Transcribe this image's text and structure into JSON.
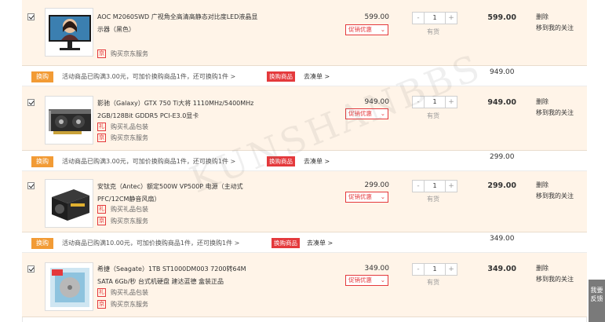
{
  "items": [
    {
      "title": "AOC M2060SWD 广视角全高清高静态对比度LED液晶显示器（黑色）",
      "services": [
        {
          "icon": "京",
          "label": "购买京东服务"
        }
      ],
      "unit_price": "599.00",
      "promo_select": "促销优惠",
      "qty": "1",
      "stock": "有货",
      "subtotal": "599.00",
      "ops": [
        "删除",
        "移到我的关注"
      ]
    },
    {
      "title": "影驰（Galaxy）GTX 750 Ti大将 1110MHz/5400MHz 2GB/128Bit GDDR5 PCI-E3.0显卡",
      "services": [
        {
          "icon": "礼",
          "label": "购买礼品包装"
        },
        {
          "icon": "京",
          "label": "购买京东服务"
        }
      ],
      "unit_price": "949.00",
      "promo_select": "促销优惠",
      "qty": "1",
      "stock": "有货",
      "subtotal": "949.00",
      "ops": [
        "删除",
        "移到我的关注"
      ]
    },
    {
      "title": "安钛克（Antec）额定500W VP500P 电源（主动式PFC/12CM静音风扇）",
      "services": [
        {
          "icon": "礼",
          "label": "购买礼品包装"
        },
        {
          "icon": "京",
          "label": "购买京东服务"
        }
      ],
      "unit_price": "299.00",
      "promo_select": "促销优惠",
      "qty": "1",
      "stock": "有货",
      "subtotal": "299.00",
      "ops": [
        "删除",
        "移到我的关注"
      ]
    },
    {
      "title": "希捷（Seagate）1TB ST1000DM003 7200转64M SATA 6Gb/秒 台式机硬盘 建达蓝德 盒装正品",
      "services": [
        {
          "icon": "礼",
          "label": "购买礼品包装"
        },
        {
          "icon": "京",
          "label": "购买京东服务"
        }
      ],
      "unit_price": "349.00",
      "promo_select": "促销优惠",
      "qty": "1",
      "stock": "有货",
      "subtotal": "349.00",
      "ops": [
        "删除",
        "移到我的关注"
      ]
    }
  ],
  "promos": [
    {
      "badge": "换购",
      "text": "活动商品已购满3.00元，可加价换购商品1件，还可换购1件 >",
      "tag": "换购商品",
      "link": "去凑单 >",
      "amount": "949.00"
    },
    {
      "badge": "换购",
      "text": "活动商品已购满3.00元，可加价换购商品1件，还可换购1件 >",
      "tag": "换购商品",
      "link": "去凑单 >",
      "amount": "299.00"
    },
    {
      "badge": "换购",
      "text": "活动商品已购满10.00元，可加价换购商品1件，还可换购1件 >",
      "tag": "换购商品",
      "link": "去凑单 >",
      "amount": "349.00"
    }
  ],
  "qty_minus": "-",
  "qty_plus": "+",
  "watermark": "KUNSHANBBS",
  "side_tab": "我要反馈",
  "colors": {
    "row_bg": "#fff4e8",
    "accent_red": "#e4393c",
    "badge_orange": "#f29b35"
  }
}
